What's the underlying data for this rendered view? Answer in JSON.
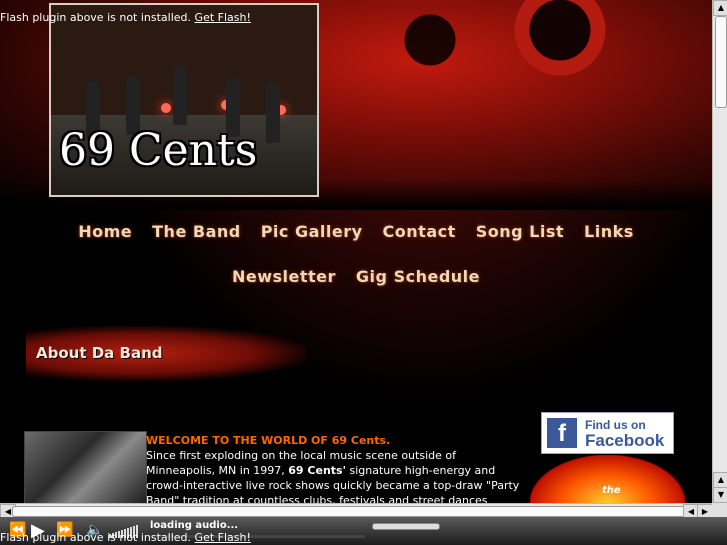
{
  "flash_notice": {
    "text": "Flash plugin above is not installed.",
    "link": "Get Flash!"
  },
  "header": {
    "band_name": "69 Cents"
  },
  "nav": {
    "row1": [
      "Home",
      "The Band",
      "Pic Gallery",
      "Contact",
      "Song List",
      "Links"
    ],
    "row2": [
      "Newsletter",
      "Gig Schedule"
    ]
  },
  "section": {
    "title": "About Da Band"
  },
  "content": {
    "welcome_prefix": "WELCOME TO THE WORLD OF",
    "welcome_band": "69 Cents.",
    "para_1": "Since first exploding on the local music scene outside of Minneapolis, MN in 1997,",
    "para_band": "69 Cents'",
    "para_2": "signature high-energy and crowd-interactive live rock shows quickly became a top-draw \"Party Band\" tradition at countless clubs, festivals and street dances throughout the Twin Cities, greater Minnesota"
  },
  "sidebar": {
    "facebook": {
      "logo": "f",
      "line1": "Find us on",
      "line2": "Facebook"
    },
    "radio": {
      "text": "the"
    }
  },
  "player": {
    "status": "loading audio...",
    "icons": [
      "rewind-icon",
      "play-icon",
      "fast-forward-icon",
      "speaker-icon"
    ]
  }
}
